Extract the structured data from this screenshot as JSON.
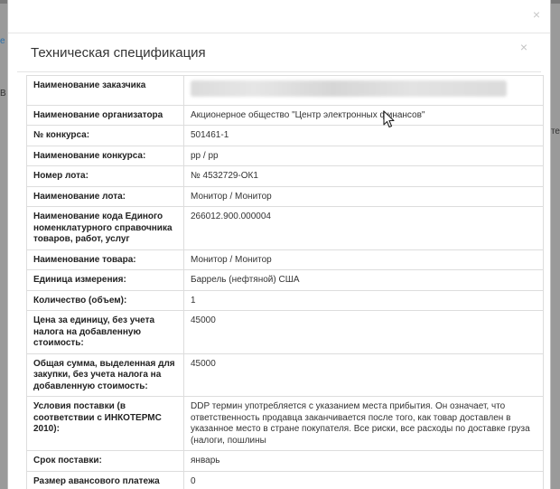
{
  "background": {
    "left_fragment_a": "е с",
    "left_fragment_b": "В",
    "right_fragment_a": "те"
  },
  "modal": {
    "close_glyph": "×",
    "title": "Техническая спецификация",
    "inner_close_glyph": "×"
  },
  "spec_rows": [
    {
      "label": "Наименование заказчика",
      "value": "",
      "redacted": true
    },
    {
      "label": "Наименование организатора",
      "value": "Акционерное общество \"Центр электронных финансов\""
    },
    {
      "label": "№ конкурса:",
      "value": "501461-1"
    },
    {
      "label": "Наименование конкурса:",
      "value": "рр / рр"
    },
    {
      "label": "Номер лота:",
      "value": "№ 4532729-ОК1"
    },
    {
      "label": "Наименование лота:",
      "value": "Монитор / Монитор"
    },
    {
      "label": "Наименование кода Единого номенклатурного справочника товаров, работ, услуг",
      "value": "266012.900.000004"
    },
    {
      "label": "Наименование товара:",
      "value": "Монитор / Монитор"
    },
    {
      "label": "Единица измерения:",
      "value": "Баррель (нефтяной) США"
    },
    {
      "label": "Количество (объем):",
      "value": "1"
    },
    {
      "label": "Цена за единицу, без учета налога на добавленную стоимость:",
      "value": "45000"
    },
    {
      "label": "Общая сумма, выделенная для закупки, без учета налога на добавленную стоимость:",
      "value": "45000"
    },
    {
      "label": "Условия поставки (в соответствии с ИНКОТЕРМС 2010):",
      "value": "DDP термин употребляется с указанием места прибытия. Он означает, что ответственность продавца заканчивается после того, как товар доставлен в указанное место в стране покупателя. Все риски, все расходы по доставке груза (налоги, пошлины"
    },
    {
      "label": "Срок поставки:",
      "value": "январь"
    },
    {
      "label": "Размер авансового платежа",
      "value": "0"
    }
  ]
}
